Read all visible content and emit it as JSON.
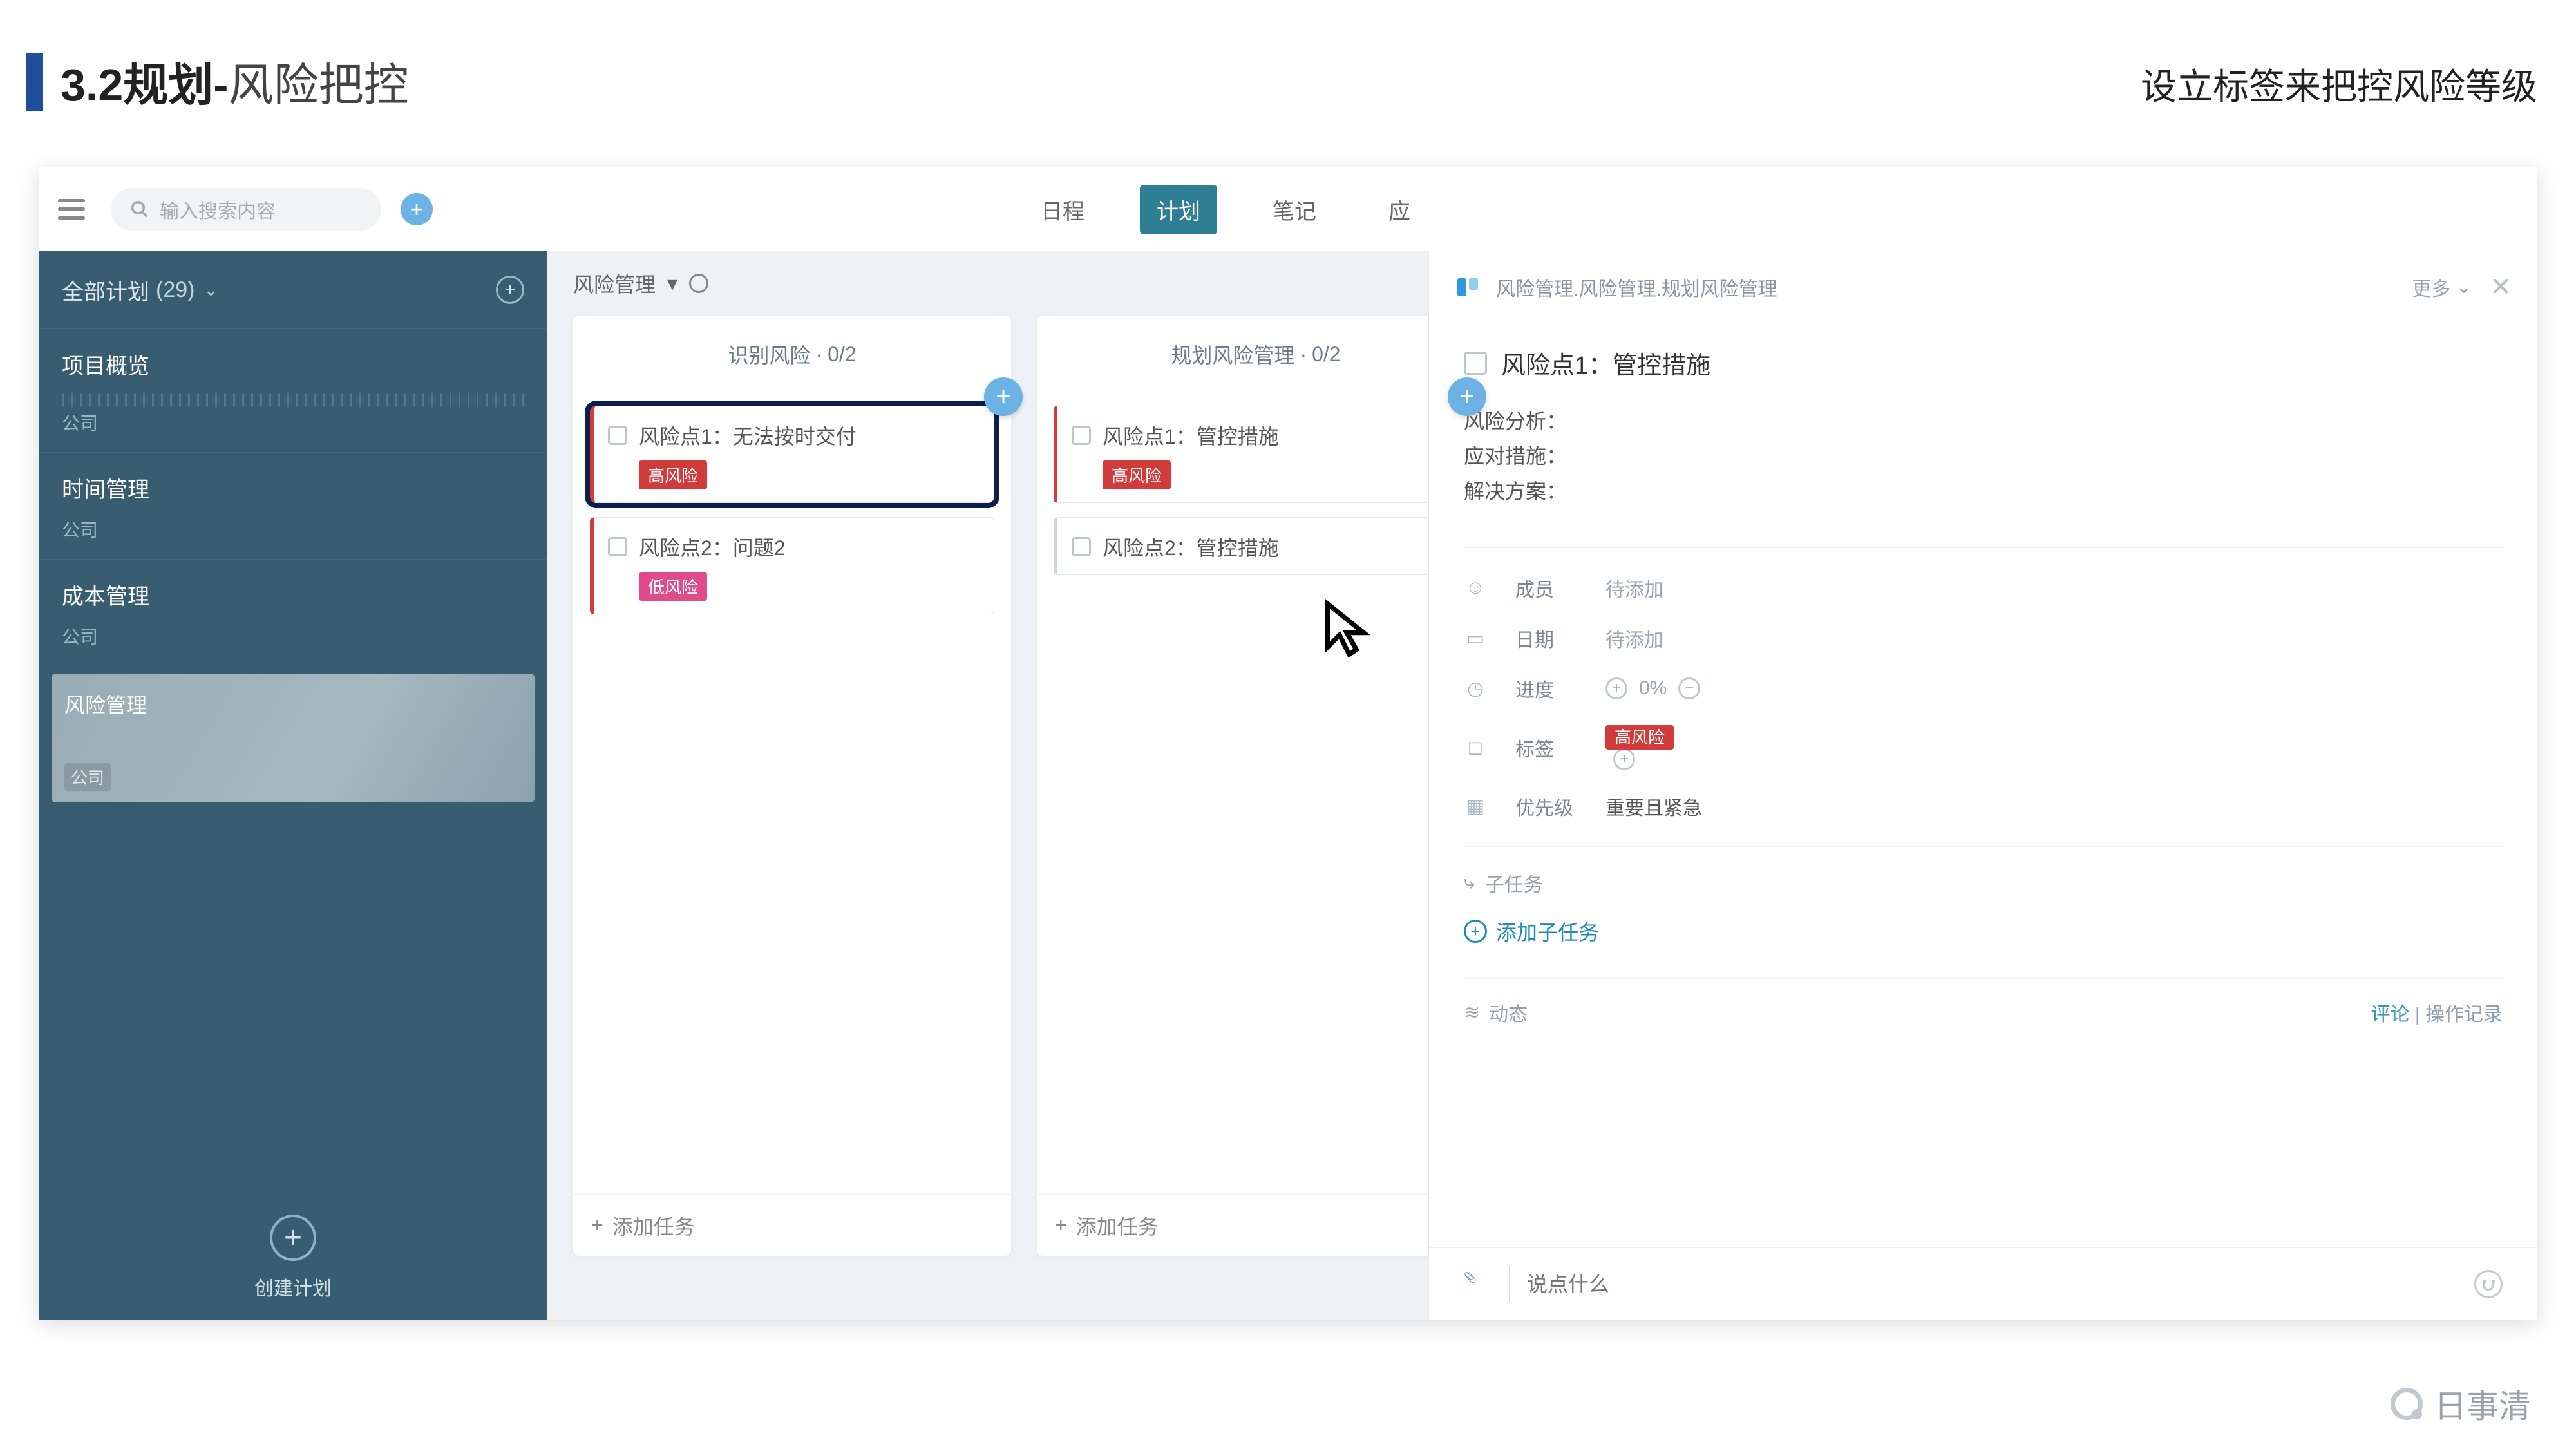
{
  "slide": {
    "title_bold": "3.2规划-",
    "title_thin": "风险把控",
    "caption": "设立标签来把控风险等级"
  },
  "topbar": {
    "search_placeholder": "输入搜索内容",
    "tabs": [
      "日程",
      "计划",
      "笔记",
      "应"
    ],
    "active_tab": 1
  },
  "sidebar": {
    "header": "全部计划",
    "count": "(29)",
    "items": [
      {
        "title": "项目概览",
        "sub": "公司",
        "ruler": true
      },
      {
        "title": "时间管理",
        "sub": "公司"
      },
      {
        "title": "成本管理",
        "sub": "公司"
      }
    ],
    "active": {
      "title": "风险管理",
      "sub": "公司"
    },
    "create": "创建计划"
  },
  "board": {
    "title": "风险管理",
    "columns": [
      {
        "title": "识别风险",
        "progress": "0/2",
        "cards": [
          {
            "title": "风险点1：无法按时交付",
            "tag": "高风险",
            "tag_kind": "high",
            "selected": true
          },
          {
            "title": "风险点2：问题2",
            "tag": "低风险",
            "tag_kind": "low"
          }
        ],
        "add": "添加任务"
      },
      {
        "title": "规划风险管理",
        "progress": "0/2",
        "cards": [
          {
            "title": "风险点1：管控措施",
            "tag": "高风险",
            "tag_kind": "high"
          },
          {
            "title": "风险点2：管控措施"
          }
        ],
        "add": "添加任务"
      }
    ]
  },
  "panel": {
    "breadcrumb": "风险管理.风险管理.规划风险管理",
    "more": "更多",
    "title": "风险点1：管控措施",
    "desc": [
      "风险分析：",
      "应对措施：",
      "解决方案："
    ],
    "meta": {
      "member_label": "成员",
      "member_val": "待添加",
      "date_label": "日期",
      "date_val": "待添加",
      "prog_label": "进度",
      "prog_val": "0%",
      "tag_label": "标签",
      "tag_val": "高风险",
      "prio_label": "优先级",
      "prio_val": "重要且紧急"
    },
    "subtask": "子任务",
    "add_sub": "添加子任务",
    "activity": "动态",
    "comments_tab": "评论",
    "log_tab": "操作记录",
    "comment_placeholder": "说点什么"
  },
  "brand": "日事清"
}
